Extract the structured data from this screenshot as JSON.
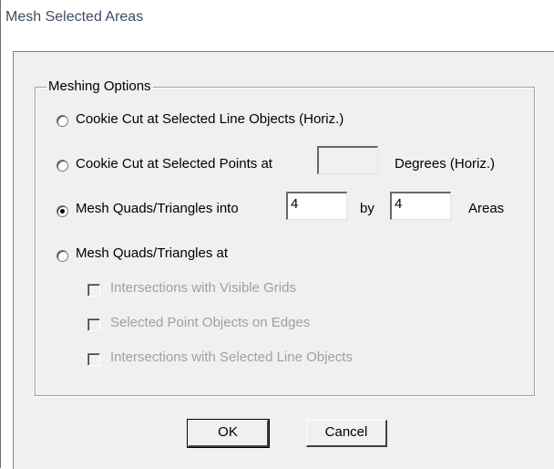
{
  "window": {
    "title": "Mesh Selected Areas"
  },
  "group": {
    "label": "Meshing Options"
  },
  "options": {
    "cookie_cut_lines": {
      "label": "Cookie Cut at Selected Line Objects (Horiz.)",
      "selected": false
    },
    "cookie_cut_points": {
      "label": "Cookie Cut at Selected Points at",
      "degrees_value": "",
      "suffix": "Degrees (Horiz.)",
      "selected": false
    },
    "mesh_into": {
      "label": "Mesh Quads/Triangles into",
      "value1": "4",
      "by_label": "by",
      "value2": "4",
      "suffix": "Areas",
      "selected": true
    },
    "mesh_at": {
      "label": "Mesh Quads/Triangles at",
      "selected": false
    }
  },
  "suboptions": [
    {
      "label": "Intersections with Visible Grids",
      "checked": false,
      "enabled": false
    },
    {
      "label": "Selected Point Objects on Edges",
      "checked": false,
      "enabled": false
    },
    {
      "label": "Intersections with Selected Line Objects",
      "checked": false,
      "enabled": false
    }
  ],
  "buttons": {
    "ok": "OK",
    "cancel": "Cancel"
  }
}
